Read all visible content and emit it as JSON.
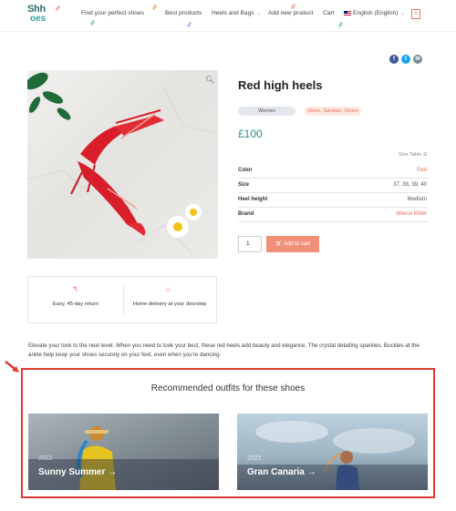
{
  "header": {
    "logo_line1": "Shh",
    "logo_line2": "oes",
    "nav": [
      "Find your perfect shoes",
      "Best products",
      "Heels and Bags",
      "Add new product",
      "Cart"
    ],
    "language": "English (English)",
    "cart_count": "0"
  },
  "product": {
    "title": "Red high heels",
    "tag": "Women",
    "categories": "Heels, Sandals, Shoes",
    "price": "£100",
    "size_table_label": "Size Table ☰",
    "attributes": [
      {
        "key": "Color",
        "value": "Red"
      },
      {
        "key": "Size",
        "value": "37, 38, 39, 40"
      },
      {
        "key": "Heel height",
        "value": "Medium"
      },
      {
        "key": "Brand",
        "value": "Milena Miller"
      }
    ],
    "quantity": "1",
    "add_to_cart_label": "Add to cart"
  },
  "features": [
    {
      "icon": "return-arrow-icon",
      "text": "Easy, 45-day return"
    },
    {
      "icon": "home-icon",
      "text": "Home delivery at your doorstep"
    }
  ],
  "description": "Elevate your look to the next level. When you need to look your best, these red heels add beauty and elegance. The crystal detailing sparkles. Buckles at the ankle help keep your shoes securely on your feet, even when you're dancing.",
  "recommended": {
    "title": "Recommended outfits for these shoes",
    "cards": [
      {
        "year": "2022",
        "name": "Sunny Summer"
      },
      {
        "year": "2022",
        "name": "Gran Canaria"
      }
    ]
  },
  "colors": {
    "accent": "#e8735f",
    "price": "#2f8f84",
    "highlight_box": "#e03a32"
  }
}
